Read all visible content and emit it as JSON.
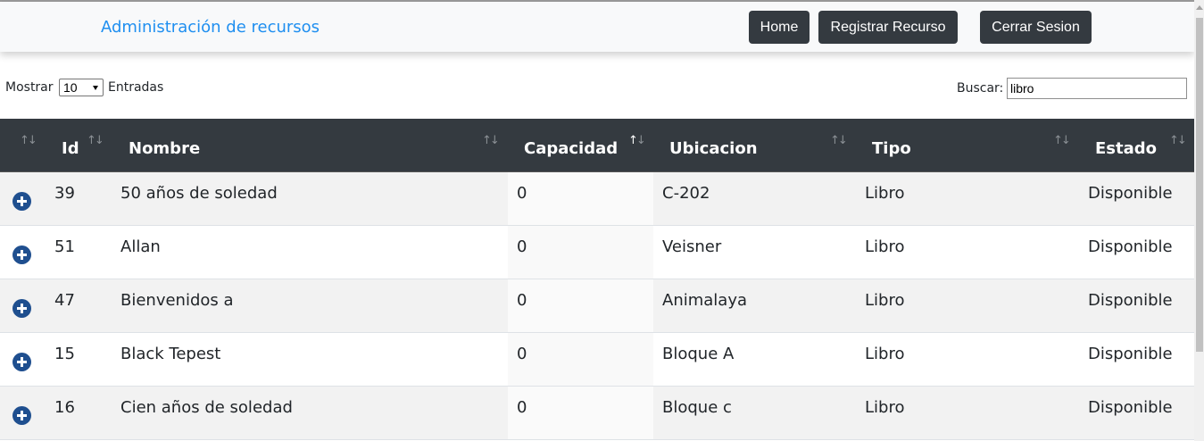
{
  "navbar": {
    "brand": "Administración de recursos",
    "buttons": [
      "Home",
      "Registrar Recurso",
      "Cerrar Sesion"
    ]
  },
  "controls": {
    "show_label": "Mostrar",
    "page_size": "10",
    "entries_label": "Entradas",
    "search_label": "Buscar:",
    "search_value": "libro"
  },
  "table": {
    "columns": [
      "Id",
      "Nombre",
      "Capacidad",
      "Ubicacion",
      "Tipo",
      "Estado"
    ],
    "sorted_column": "Capacidad",
    "rows": [
      {
        "id": "39",
        "nombre": "50 años de soledad",
        "capacidad": "0",
        "ubicacion": "C-202",
        "tipo": "Libro",
        "estado": "Disponible"
      },
      {
        "id": "51",
        "nombre": "Allan",
        "capacidad": "0",
        "ubicacion": "Veisner",
        "tipo": "Libro",
        "estado": "Disponible"
      },
      {
        "id": "47",
        "nombre": "Bienvenidos a",
        "capacidad": "0",
        "ubicacion": "Animalaya",
        "tipo": "Libro",
        "estado": "Disponible"
      },
      {
        "id": "15",
        "nombre": "Black Tepest",
        "capacidad": "0",
        "ubicacion": "Bloque A",
        "tipo": "Libro",
        "estado": "Disponible"
      },
      {
        "id": "16",
        "nombre": "Cien años de soledad",
        "capacidad": "0",
        "ubicacion": "Bloque c",
        "tipo": "Libro",
        "estado": "Disponible"
      }
    ]
  },
  "icons": {
    "expand": "plus-circle-icon",
    "sort": "sort-arrows-icon"
  },
  "colors": {
    "brand": "#1f8ff0",
    "dark": "#343a40",
    "expand_icon": "#1f4f8f"
  }
}
